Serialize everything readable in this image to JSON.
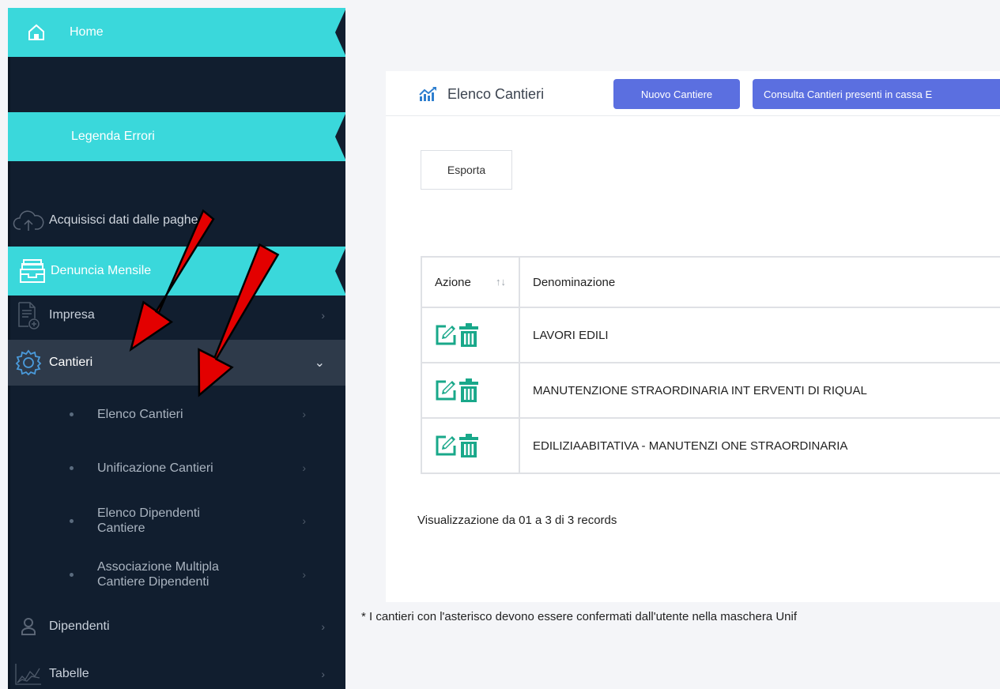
{
  "sidebar": {
    "home": "Home",
    "legenda": "Legenda Errori",
    "acquisisci": "Acquisisci dati dalle paghe",
    "denuncia": "Denuncia Mensile",
    "impresa": "Impresa",
    "cantieri": "Cantieri",
    "cantieri_sub": {
      "elenco": "Elenco Cantieri",
      "unificazione": "Unificazione Cantieri",
      "dipendenti_l1": "Elenco Dipendenti",
      "dipendenti_l2": "Cantiere",
      "associazione_l1": "Associazione Multipla",
      "associazione_l2": "Cantiere Dipendenti"
    },
    "dipendenti": "Dipendenti",
    "tabelle": "Tabelle",
    "chevron_right": "›",
    "chevron_down": "⌄"
  },
  "main": {
    "title": "Elenco Cantieri",
    "btn_nuovo": "Nuovo Cantiere",
    "btn_consulta": "Consulta Cantieri presenti in cassa E",
    "btn_esporta": "Esporta",
    "table": {
      "headers": [
        "Azione",
        "Denominazione"
      ],
      "sort_glyph": "↑↓",
      "rows": [
        "LAVORI EDILI",
        "MANUTENZIONE STRAORDINARIA INT ERVENTI DI RIQUAL",
        "EDILIZIAABITATIVA - MANUTENZI ONE STRAORDINARIA"
      ]
    },
    "records": "Visualizzazione da 01 a 3 di 3 records",
    "footnote": "* I cantieri con l'asterisco devono essere confermati dall'utente nella maschera Unif"
  },
  "colors": {
    "sidebar_bg": "#111e2f",
    "accent_cyan": "#3ad8db",
    "active_item_bg": "#2e3a4a",
    "button_blue": "#5b6fe0",
    "action_green": "#19a88a",
    "annotation_red": "#e30000"
  },
  "icons": {
    "home": "home-icon",
    "acquisisci": "cloud-upload-icon",
    "denuncia": "inbox-tray-icon",
    "impresa": "document-add-icon",
    "cantieri": "gear-icon",
    "dipendenti": "user-icon",
    "tabelle": "chart-area-icon",
    "title": "line-chart-icon",
    "edit": "edit-icon",
    "delete": "trash-icon"
  }
}
